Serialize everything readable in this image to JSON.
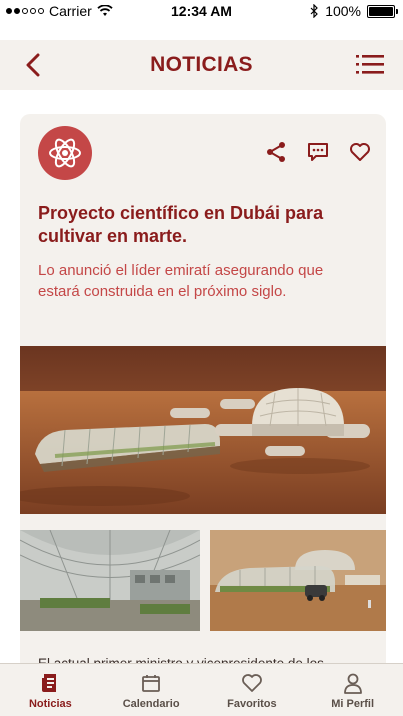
{
  "status_bar": {
    "carrier": "Carrier",
    "time": "12:34 AM",
    "battery": "100%",
    "battery_level": 1.0
  },
  "header": {
    "title": "NOTICIAS",
    "back_icon": "chevron-left-icon",
    "menu_icon": "list-menu-icon"
  },
  "article": {
    "category_icon": "atom-icon",
    "title": "Proyecto científico en Dubái para cultivar en marte.",
    "subtitle": "Lo anunció el líder emiratí asegurando que estará construida en el próximo siglo.",
    "body": "El actual primer ministro y vicepresidente de los Emiratos Árabes Unidos, anunció en la Cumbre de Gobierno",
    "actions": [
      "share-icon",
      "comment-icon",
      "heart-icon"
    ]
  },
  "tabs": [
    {
      "label": "Noticias",
      "icon": "newspaper-icon",
      "active": true
    },
    {
      "label": "Calendario",
      "icon": "calendar-icon",
      "active": false
    },
    {
      "label": "Favoritos",
      "icon": "heart-icon",
      "active": false
    },
    {
      "label": "Mi Perfil",
      "icon": "person-icon",
      "active": false
    }
  ],
  "colors": {
    "accent": "#8a1c1c",
    "accent_light": "#c44747",
    "background": "#f4f1ed"
  }
}
